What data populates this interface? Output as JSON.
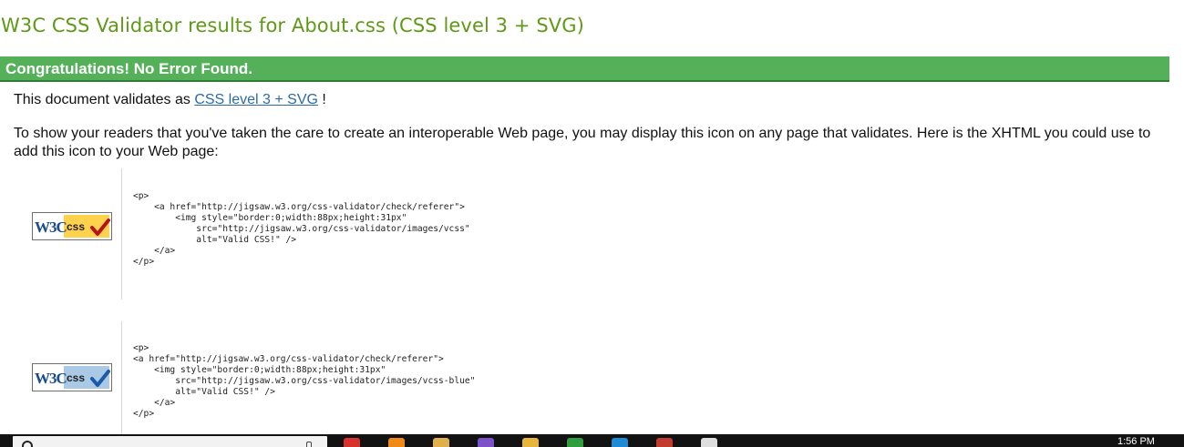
{
  "header": {
    "title": "W3C CSS Validator results for About.css (CSS level 3 + SVG)"
  },
  "banner": {
    "text": "Congratulations! No Error Found."
  },
  "intro": {
    "prefix": "This document validates as ",
    "link_label": "CSS level 3 + SVG",
    "suffix": " !"
  },
  "explanation": "To show your readers that you've taken the care to create an interoperable Web page, you may display this icon on any page that validates. Here is the XHTML you could use to add this icon to your Web page:",
  "badges": [
    {
      "w3c_text": "W3C",
      "css_text": "css",
      "color": "#ffd24d",
      "check_color": "#b3151b",
      "code": "<p>\n    <a href=\"http://jigsaw.w3.org/css-validator/check/referer\">\n        <img style=\"border:0;width:88px;height:31px\"\n            src=\"http://jigsaw.w3.org/css-validator/images/vcss\"\n            alt=\"Valid CSS!\" />\n    </a>\n</p>"
    },
    {
      "w3c_text": "W3C",
      "css_text": "css",
      "color": "#a9c9e4",
      "check_color": "#1c5aa8",
      "code": "<p>\n<a href=\"http://jigsaw.w3.org/css-validator/check/referer\">\n    <img style=\"border:0;width:88px;height:31px\"\n        src=\"http://jigsaw.w3.org/css-validator/images/vcss-blue\"\n        alt=\"Valid CSS!\" />\n    </a>\n</p>"
    }
  ],
  "taskbar": {
    "clock": "1:56 PM",
    "icons": [
      {
        "name": "chrome-icon",
        "color": "#d8322a"
      },
      {
        "name": "vlc-icon",
        "color": "#f08a16"
      },
      {
        "name": "paint-icon",
        "color": "#e2b04a"
      },
      {
        "name": "viber-icon",
        "color": "#7b52c7"
      },
      {
        "name": "folder-icon",
        "color": "#e7b53c"
      },
      {
        "name": "app-green-icon",
        "color": "#2e9e3e"
      },
      {
        "name": "store-icon",
        "color": "#1f8ad6"
      },
      {
        "name": "app-red-icon",
        "color": "#c23b2c"
      },
      {
        "name": "window-icon",
        "color": "#dddddd"
      }
    ]
  }
}
